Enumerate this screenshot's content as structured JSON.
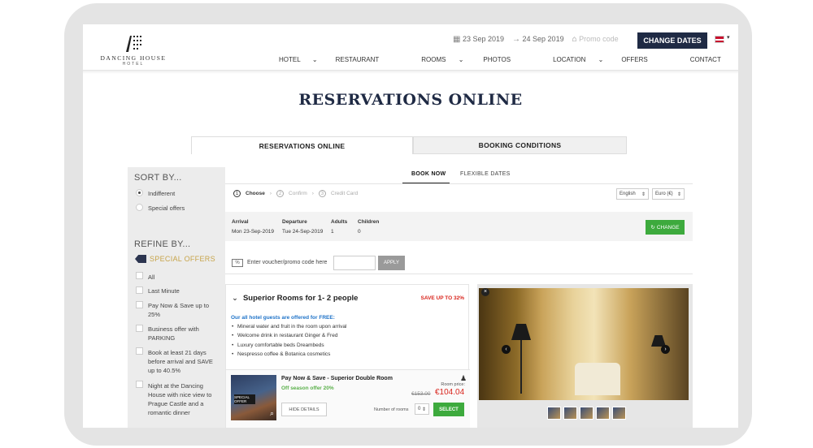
{
  "header": {
    "logo_name": "DANCING HOUSE",
    "logo_sub": "HOTEL",
    "arrival_date": "23 Sep 2019",
    "departure_date": "24 Sep 2019",
    "promo_placeholder": "Promo code",
    "change_dates": "CHANGE DATES",
    "nav": [
      {
        "label": "HOTEL",
        "caret": "⌄"
      },
      {
        "label": "RESTAURANT",
        "caret": ""
      },
      {
        "label": "ROOMS",
        "caret": "⌄"
      },
      {
        "label": "PHOTOS",
        "caret": ""
      },
      {
        "label": "LOCATION",
        "caret": "⌄"
      },
      {
        "label": "OFFERS",
        "caret": ""
      },
      {
        "label": "CONTACT",
        "caret": ""
      }
    ]
  },
  "page_title": "RESERVATIONS ONLINE",
  "tabs": [
    "RESERVATIONS ONLINE",
    "BOOKING CONDITIONS"
  ],
  "sidebar": {
    "sort_heading": "SORT BY...",
    "sort_options": [
      "Indifferent",
      "Special offers"
    ],
    "refine_heading": "REFINE BY...",
    "special_offers": "SPECIAL OFFERS",
    "filters": [
      "All",
      "Last Minute",
      "Pay Now & Save up to 25%",
      "Business offer with PARKING",
      "Book at least 21 days before arrival and SAVE up to 40.5%",
      "Night at the Dancing House with nice view to Prague Castle and a romantic dinner"
    ]
  },
  "booking": {
    "subtabs": [
      "BOOK NOW",
      "FLEXIBLE DATES"
    ],
    "steps": [
      "Choose",
      "Confirm",
      "Credit Card"
    ],
    "language": "English",
    "currency": "Euro (€)",
    "headers": {
      "arrival": "Arrival",
      "departure": "Departure",
      "adults": "Adults",
      "children": "Children"
    },
    "values": {
      "arrival": "Mon 23-Sep-2019",
      "departure": "Tue 24-Sep-2019",
      "adults": "1",
      "children": "0"
    },
    "change": "CHANGE",
    "voucher_label": "Enter voucher/promo code here",
    "apply": "APPLY"
  },
  "room": {
    "title": "Superior Rooms for 1- 2 people",
    "save": "SAVE UP TO 32%",
    "free_heading": "Our all hotel guests are offered for FREE:",
    "amenities": [
      "Mineral water and fruit in the room upon arrival",
      "Welcome drink in restaurant Ginger & Fred",
      "Luxury comfortable beds Dreambeds",
      "Nespresso coffee & Botanica cosmetics"
    ],
    "offer": {
      "title": "Pay Now & Save - Superior Double Room",
      "subtitle": "Off season offer 20%",
      "badge": "SPECIAL OFFER",
      "hide_details": "HIDE DETAILS",
      "room_price_label": "Room price:",
      "old_price": "€153.00",
      "new_price": "€104.04",
      "num_rooms_label": "Number of rooms",
      "quantity": "0",
      "select": "SELECT"
    }
  }
}
